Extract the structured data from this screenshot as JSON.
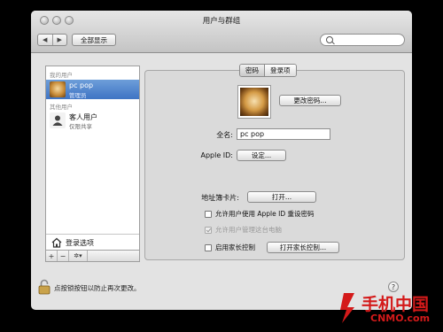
{
  "window": {
    "title": "用户与群组"
  },
  "toolbar": {
    "back_glyph": "◀",
    "forward_glyph": "▶",
    "show_all_label": "全部显示",
    "search_placeholder": ""
  },
  "sidebar": {
    "my_users_label": "我的用户",
    "other_users_label": "其他用户",
    "users": [
      {
        "name": "pc pop",
        "role": "管理员",
        "selected": true
      },
      {
        "name": "客人用户",
        "role": "仅限共享",
        "selected": false
      }
    ],
    "login_options_label": "登录选项",
    "controls": {
      "add": "+",
      "remove": "−",
      "action": "✲▾"
    }
  },
  "tabs": [
    {
      "label": "密码",
      "active": true
    },
    {
      "label": "登录项",
      "active": false
    }
  ],
  "detail": {
    "change_password_button": "更改密码...",
    "full_name_label": "全名:",
    "full_name_value": "pc pop",
    "apple_id_label": "Apple ID:",
    "apple_id_button": "设定...",
    "address_card_label": "地址簿卡片:",
    "open_button": "打开...",
    "allow_reset_label": "允许用户使用 Apple ID 重设密码",
    "allow_reset_checked": false,
    "allow_admin_label": "允许用户管理这台电脑",
    "allow_admin_checked": true,
    "parental_label": "启用家长控制",
    "parental_checked": false,
    "parental_button": "打开家长控制..."
  },
  "footer": {
    "lock_text": "点按锁按钮以防止再次更改。",
    "help_glyph": "?"
  },
  "watermark": {
    "main": "手机中国",
    "sub": "CNMO.com"
  },
  "colors": {
    "selection": "#3f74c4",
    "watermark": "#d41a1a"
  }
}
